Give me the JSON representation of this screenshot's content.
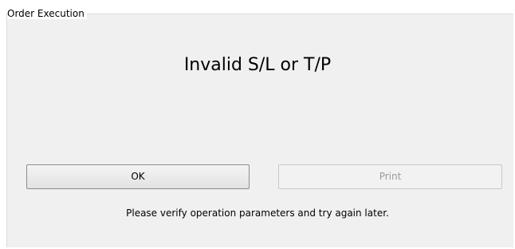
{
  "dialog": {
    "group_title": "Order Execution",
    "message": "Invalid S/L or T/P",
    "ok_label": "OK",
    "print_label": "Print",
    "hint": "Please verify operation parameters and try again later."
  }
}
